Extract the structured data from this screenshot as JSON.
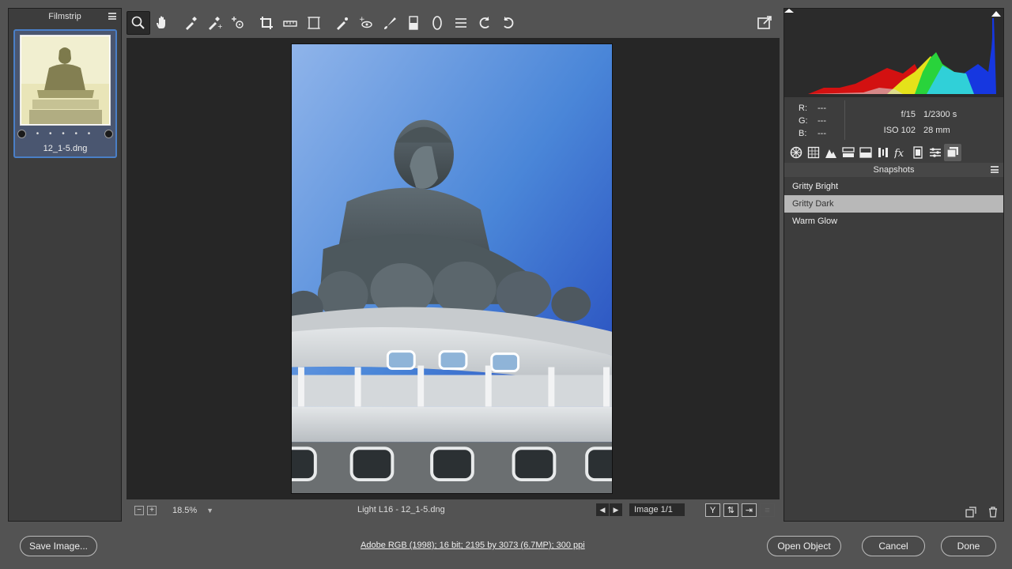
{
  "filmstrip": {
    "title": "Filmstrip",
    "thumbnail": {
      "filename": "12_1-5.dng",
      "rating_dots": "• • • • •"
    }
  },
  "toolbar": {
    "tools": [
      "zoom-icon",
      "hand-icon",
      "white-balance-icon",
      "color-sampler-icon",
      "target-adjust-icon",
      "crop-icon",
      "straighten-icon",
      "transform-icon",
      "spot-removal-icon",
      "red-eye-icon",
      "adjustment-brush-icon",
      "graduated-filter-icon",
      "radial-filter-icon",
      "preferences-icon",
      "rotate-left-icon",
      "rotate-right-icon"
    ],
    "active_tool": "zoom-icon"
  },
  "status": {
    "zoom_minus": "−",
    "zoom_plus": "+",
    "zoom_level": "18.5%",
    "file_label": "Light L16  -  12_1-5.dng",
    "image_count": "Image 1/1",
    "view_y": "Y"
  },
  "readout": {
    "r_label": "R:",
    "r_value": "---",
    "g_label": "G:",
    "g_value": "---",
    "b_label": "B:",
    "b_value": "---",
    "aperture": "f/15",
    "shutter": "1/2300 s",
    "iso": "ISO 102",
    "focal": "28 mm"
  },
  "panel": {
    "tabs": [
      "basic-icon",
      "tone-curve-icon",
      "detail-icon",
      "hsl-icon",
      "split-toning-icon",
      "lens-icon",
      "effects-icon",
      "camera-calibration-icon",
      "presets-icon",
      "snapshots-icon"
    ],
    "active_tab": "snapshots-icon",
    "snapshots_title": "Snapshots",
    "snapshots": [
      {
        "label": "Gritty Bright",
        "selected": false
      },
      {
        "label": "Gritty Dark",
        "selected": true
      },
      {
        "label": "Warm Glow",
        "selected": false
      }
    ]
  },
  "bottom": {
    "save_label": "Save Image...",
    "workflow_label": "Adobe RGB (1998); 16 bit; 2195 by 3073 (6.7MP); 300 ppi",
    "open_label": "Open Object",
    "cancel_label": "Cancel",
    "done_label": "Done"
  }
}
